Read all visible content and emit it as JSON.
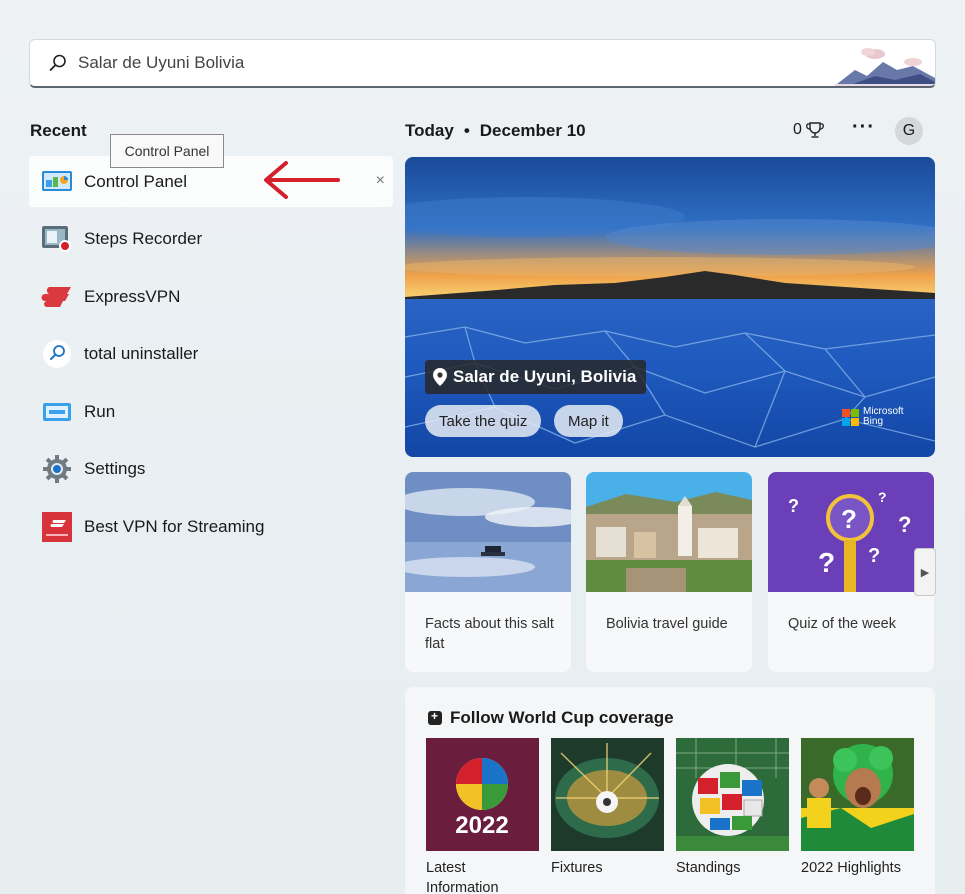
{
  "search": {
    "value": "Salar de Uyuni Bolivia",
    "icon": "search-icon"
  },
  "recent": {
    "title": "Recent",
    "tooltip": "Control Panel",
    "items": [
      {
        "label": "Control Panel",
        "icon": "control-panel-icon"
      },
      {
        "label": "Steps Recorder",
        "icon": "steps-recorder-icon"
      },
      {
        "label": "ExpressVPN",
        "icon": "expressvpn-icon"
      },
      {
        "label": "total uninstaller",
        "icon": "search-icon"
      },
      {
        "label": "Run",
        "icon": "run-icon"
      },
      {
        "label": "Settings",
        "icon": "gear-icon"
      },
      {
        "label": "Best VPN for Streaming",
        "icon": "web-page-icon"
      }
    ],
    "remove_symbol": "×"
  },
  "header": {
    "today": "Today",
    "bullet": "•",
    "date": "December 10",
    "points": "0",
    "more": "···",
    "avatar": "G"
  },
  "hero": {
    "title": "Salar de Uyuni, Bolivia",
    "quiz_label": "Take the quiz",
    "map_label": "Map it",
    "bing_line1": "Microsoft",
    "bing_line2": "Bing"
  },
  "cards": [
    {
      "caption": "Facts about this salt flat"
    },
    {
      "caption": "Bolivia travel guide"
    },
    {
      "caption": "Quiz of the week"
    }
  ],
  "world_cup": {
    "title": "Follow World Cup coverage",
    "tiles": [
      {
        "label": "Latest Information",
        "text": "2022"
      },
      {
        "label": "Fixtures"
      },
      {
        "label": "Standings"
      },
      {
        "label": "2022 Highlights"
      }
    ]
  },
  "colors": {
    "arrow": "#d3202a",
    "accent": "#1a73c8"
  }
}
